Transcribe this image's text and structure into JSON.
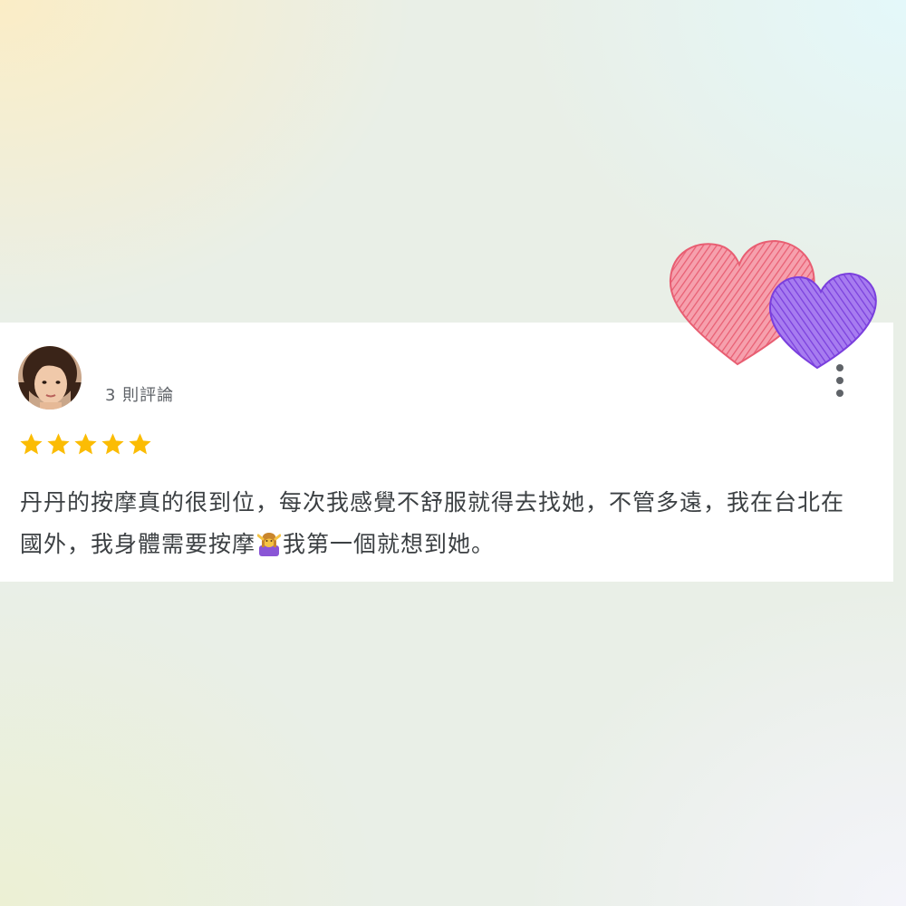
{
  "review": {
    "review_count": "3 則評論",
    "rating": 5,
    "rating_max": 5,
    "text_part1": "丹丹的按摩真的很到位，每次我感覺不舒服就得去找她，不管多遠，我在台北在國外，我身體需要按摩",
    "text_part2": "我第一個就想到她。"
  },
  "icons": {
    "avatar": "avatar",
    "star": "star-icon",
    "more": "more-vert-icon",
    "emoji": "person-getting-massage-emoji",
    "hearts": "hearts-doodle"
  },
  "colors": {
    "star": "#fbbc04",
    "heart_pink": "#f0798a",
    "heart_purple": "#8a55e4",
    "text": "#3c4043",
    "secondary_text": "#5f6368"
  }
}
